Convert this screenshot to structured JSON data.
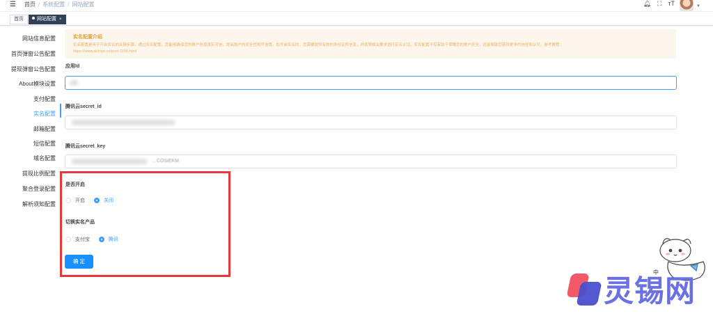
{
  "header": {
    "breadcrumb": [
      "首页",
      "系统配置",
      "网站配置"
    ]
  },
  "tags": {
    "home": "首页",
    "active": "网站配置",
    "close": "×"
  },
  "sidebar": {
    "items": [
      {
        "label": "网站信息配置",
        "active": false
      },
      {
        "label": "首页弹窗公告配置",
        "active": false
      },
      {
        "label": "提现弹窗公告配置",
        "active": false
      },
      {
        "label": "About模块设置",
        "active": false
      },
      {
        "label": "支付配置",
        "active": false
      },
      {
        "label": "实名配置",
        "active": true
      },
      {
        "label": "邮箱配置",
        "active": false
      },
      {
        "label": "短信配置",
        "active": false
      },
      {
        "label": "域名配置",
        "active": false
      },
      {
        "label": "提现比例配置",
        "active": false
      },
      {
        "label": "聚合登录配置",
        "active": false
      },
      {
        "label": "解析须知配置",
        "active": false
      }
    ]
  },
  "alert": {
    "title": "实名配置介绍",
    "lines": [
      "实名配置是用于开启实名的关键步骤。通过实名配置，您能够确保您的账户信息真实可信，提高账户的安全性和可信度。在开启实名时，您需要提供有效的身份证件信息，并按照相关要求进行实名认证。实名配置不仅有助于保障您的账户安全，还能帮助您获得更多的信任和认可。参考教程：",
      "https://www.ariingo.cn/post-1150.html"
    ]
  },
  "form": {
    "app_id": {
      "label": "应用Id",
      "value": ""
    },
    "secret_id": {
      "label": "腾讯云secret_id",
      "value": ""
    },
    "secret_key": {
      "label": "腾讯云secret_key",
      "value": "…COSiEKM"
    },
    "enable": {
      "label": "是否开启",
      "options": [
        "开启",
        "关闭"
      ],
      "selected": "关闭"
    },
    "product": {
      "label": "切换实名产品",
      "options": [
        "支付宝",
        "腾讯"
      ],
      "selected": "腾讯"
    },
    "submit_label": "确 定"
  },
  "watermark": {
    "text": "灵锡网",
    "sticker_char": "中"
  },
  "colors": {
    "primary": "#409eff",
    "button": "#1890ff",
    "highlight": "#e8363a",
    "alert_bg": "#fdf6ec",
    "alert_text": "#e6a23c",
    "tag_active": "#304156"
  }
}
